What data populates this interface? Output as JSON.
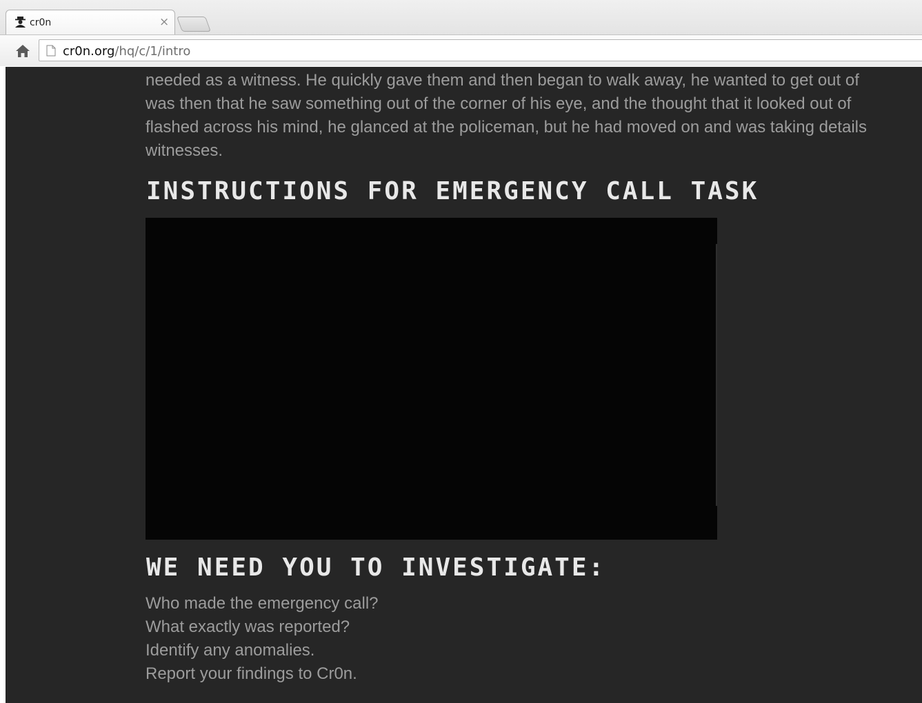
{
  "browser": {
    "tab": {
      "title": "cr0n",
      "close_glyph": "×",
      "favicon": "agent-silhouette-icon"
    },
    "address_bar": {
      "url_domain": "cr0n.org",
      "url_path": "/hq/c/1/intro"
    }
  },
  "page": {
    "story_lines": [
      "needed as a witness. He quickly gave them and then began to walk away, he wanted to get out of",
      "was then that he saw something out of the corner of his eye, and the thought that it looked out of",
      "flashed across his mind, he glanced at the policeman, but he had moved on and was taking details",
      "witnesses."
    ],
    "instructions_heading": "INSTRUCTIONS FOR EMERGENCY CALL TASK",
    "investigate_heading": "WE NEED YOU TO INVESTIGATE:",
    "tasks": [
      "Who made the emergency call?",
      "What exactly was reported?",
      "Identify any anomalies.",
      "Report your findings to Cr0n."
    ]
  },
  "colors": {
    "page_background": "#262626",
    "body_text": "#9c9c9c",
    "heading_text": "#e8e8e8",
    "video_background": "#050505"
  }
}
